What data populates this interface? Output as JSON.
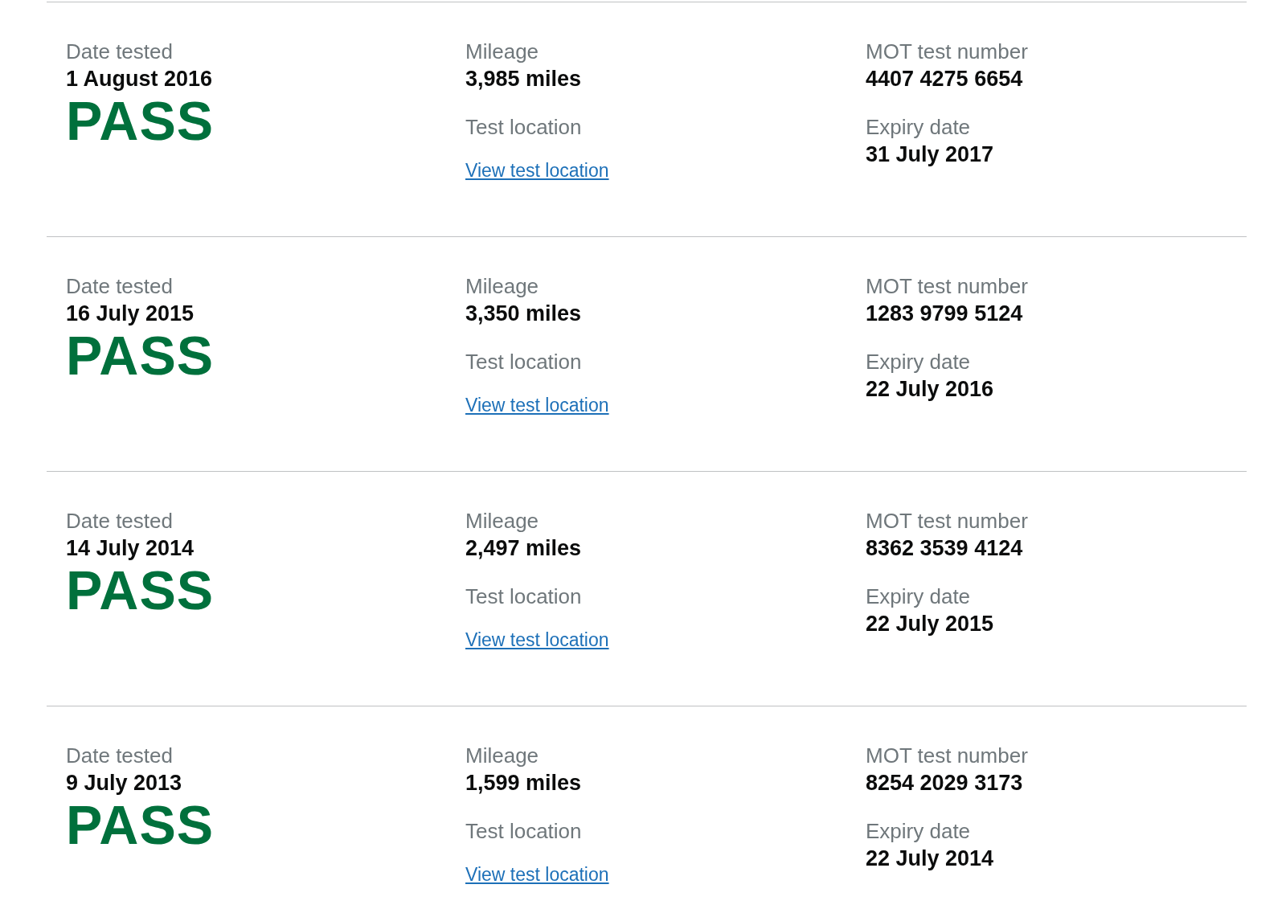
{
  "tests": [
    {
      "date_label": "Date tested",
      "date": "1 August 2016",
      "result": {
        "kind": "pass",
        "text": "PASS"
      },
      "mileage_label": "Mileage",
      "mileage": "3,985 miles",
      "location_label": "Test location",
      "location_link": "View test location",
      "number_label": "MOT test number",
      "number": "4407 4275 6654",
      "expiry_label": "Expiry date",
      "expiry": "31 July 2017"
    },
    {
      "date_label": "Date tested",
      "date": "16 July 2015",
      "result": {
        "kind": "pass",
        "text": "PASS"
      },
      "mileage_label": "Mileage",
      "mileage": "3,350 miles",
      "location_label": "Test location",
      "location_link": "View test location",
      "number_label": "MOT test number",
      "number": "1283 9799 5124",
      "expiry_label": "Expiry date",
      "expiry": "22 July 2016"
    },
    {
      "date_label": "Date tested",
      "date": "14 July 2014",
      "result": {
        "kind": "pass",
        "text": "PASS"
      },
      "mileage_label": "Mileage",
      "mileage": "2,497 miles",
      "location_label": "Test location",
      "location_link": "View test location",
      "number_label": "MOT test number",
      "number": "8362 3539 4124",
      "expiry_label": "Expiry date",
      "expiry": "22 July 2015"
    },
    {
      "date_label": "Date tested",
      "date": "9 July 2013",
      "result": {
        "kind": "pass",
        "text": "PASS"
      },
      "mileage_label": "Mileage",
      "mileage": "1,599 miles",
      "location_label": "Test location",
      "location_link": "View test location",
      "number_label": "MOT test number",
      "number": "8254 2029 3173",
      "expiry_label": "Expiry date",
      "expiry": "22 July 2014"
    }
  ]
}
